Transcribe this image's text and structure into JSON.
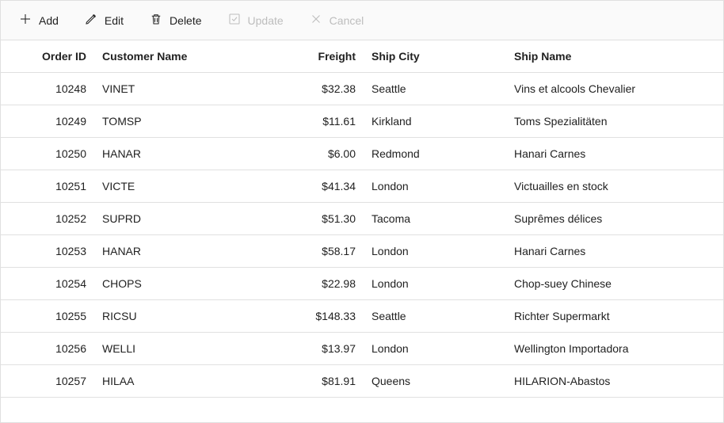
{
  "toolbar": {
    "add": "Add",
    "edit": "Edit",
    "delete": "Delete",
    "update": "Update",
    "cancel": "Cancel"
  },
  "columns": {
    "orderId": "Order ID",
    "customer": "Customer Name",
    "freight": "Freight",
    "shipCity": "Ship City",
    "shipName": "Ship Name"
  },
  "rows": [
    {
      "orderId": "10248",
      "customer": "VINET",
      "freight": "$32.38",
      "shipCity": "Seattle",
      "shipName": "Vins et alcools Chevalier"
    },
    {
      "orderId": "10249",
      "customer": "TOMSP",
      "freight": "$11.61",
      "shipCity": "Kirkland",
      "shipName": "Toms Spezialitäten"
    },
    {
      "orderId": "10250",
      "customer": "HANAR",
      "freight": "$6.00",
      "shipCity": "Redmond",
      "shipName": "Hanari Carnes"
    },
    {
      "orderId": "10251",
      "customer": "VICTE",
      "freight": "$41.34",
      "shipCity": "London",
      "shipName": "Victuailles en stock"
    },
    {
      "orderId": "10252",
      "customer": "SUPRD",
      "freight": "$51.30",
      "shipCity": "Tacoma",
      "shipName": "Suprêmes délices"
    },
    {
      "orderId": "10253",
      "customer": "HANAR",
      "freight": "$58.17",
      "shipCity": "London",
      "shipName": "Hanari Carnes"
    },
    {
      "orderId": "10254",
      "customer": "CHOPS",
      "freight": "$22.98",
      "shipCity": "London",
      "shipName": "Chop-suey Chinese"
    },
    {
      "orderId": "10255",
      "customer": "RICSU",
      "freight": "$148.33",
      "shipCity": "Seattle",
      "shipName": "Richter Supermarkt"
    },
    {
      "orderId": "10256",
      "customer": "WELLI",
      "freight": "$13.97",
      "shipCity": "London",
      "shipName": "Wellington Importadora"
    },
    {
      "orderId": "10257",
      "customer": "HILAA",
      "freight": "$81.91",
      "shipCity": "Queens",
      "shipName": "HILARION-Abastos"
    }
  ]
}
